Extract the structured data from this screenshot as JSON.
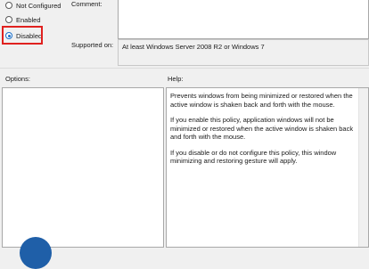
{
  "state": {
    "options": [
      {
        "label": "Not Configured",
        "checked": false
      },
      {
        "label": "Enabled",
        "checked": false
      },
      {
        "label": "Disabled",
        "checked": true
      }
    ]
  },
  "comment": {
    "label": "Comment:",
    "value": ""
  },
  "supported": {
    "label": "Supported on:",
    "value": "At least Windows Server 2008 R2 or Windows 7"
  },
  "options_panel": {
    "label": "Options:"
  },
  "help_panel": {
    "label": "Help:",
    "paragraphs": [
      "Prevents windows from being minimized or restored when the active window is shaken back and forth with the mouse.",
      "If you enable this policy, application windows will not be minimized or restored when the active window is shaken back and forth with the mouse.",
      "If you disable or do not configure this policy, this window minimizing and restoring gesture will apply."
    ]
  },
  "colors": {
    "highlight": "#e0211f",
    "radio_accent": "#1a6fc9",
    "logo": "#1f5fa8"
  }
}
